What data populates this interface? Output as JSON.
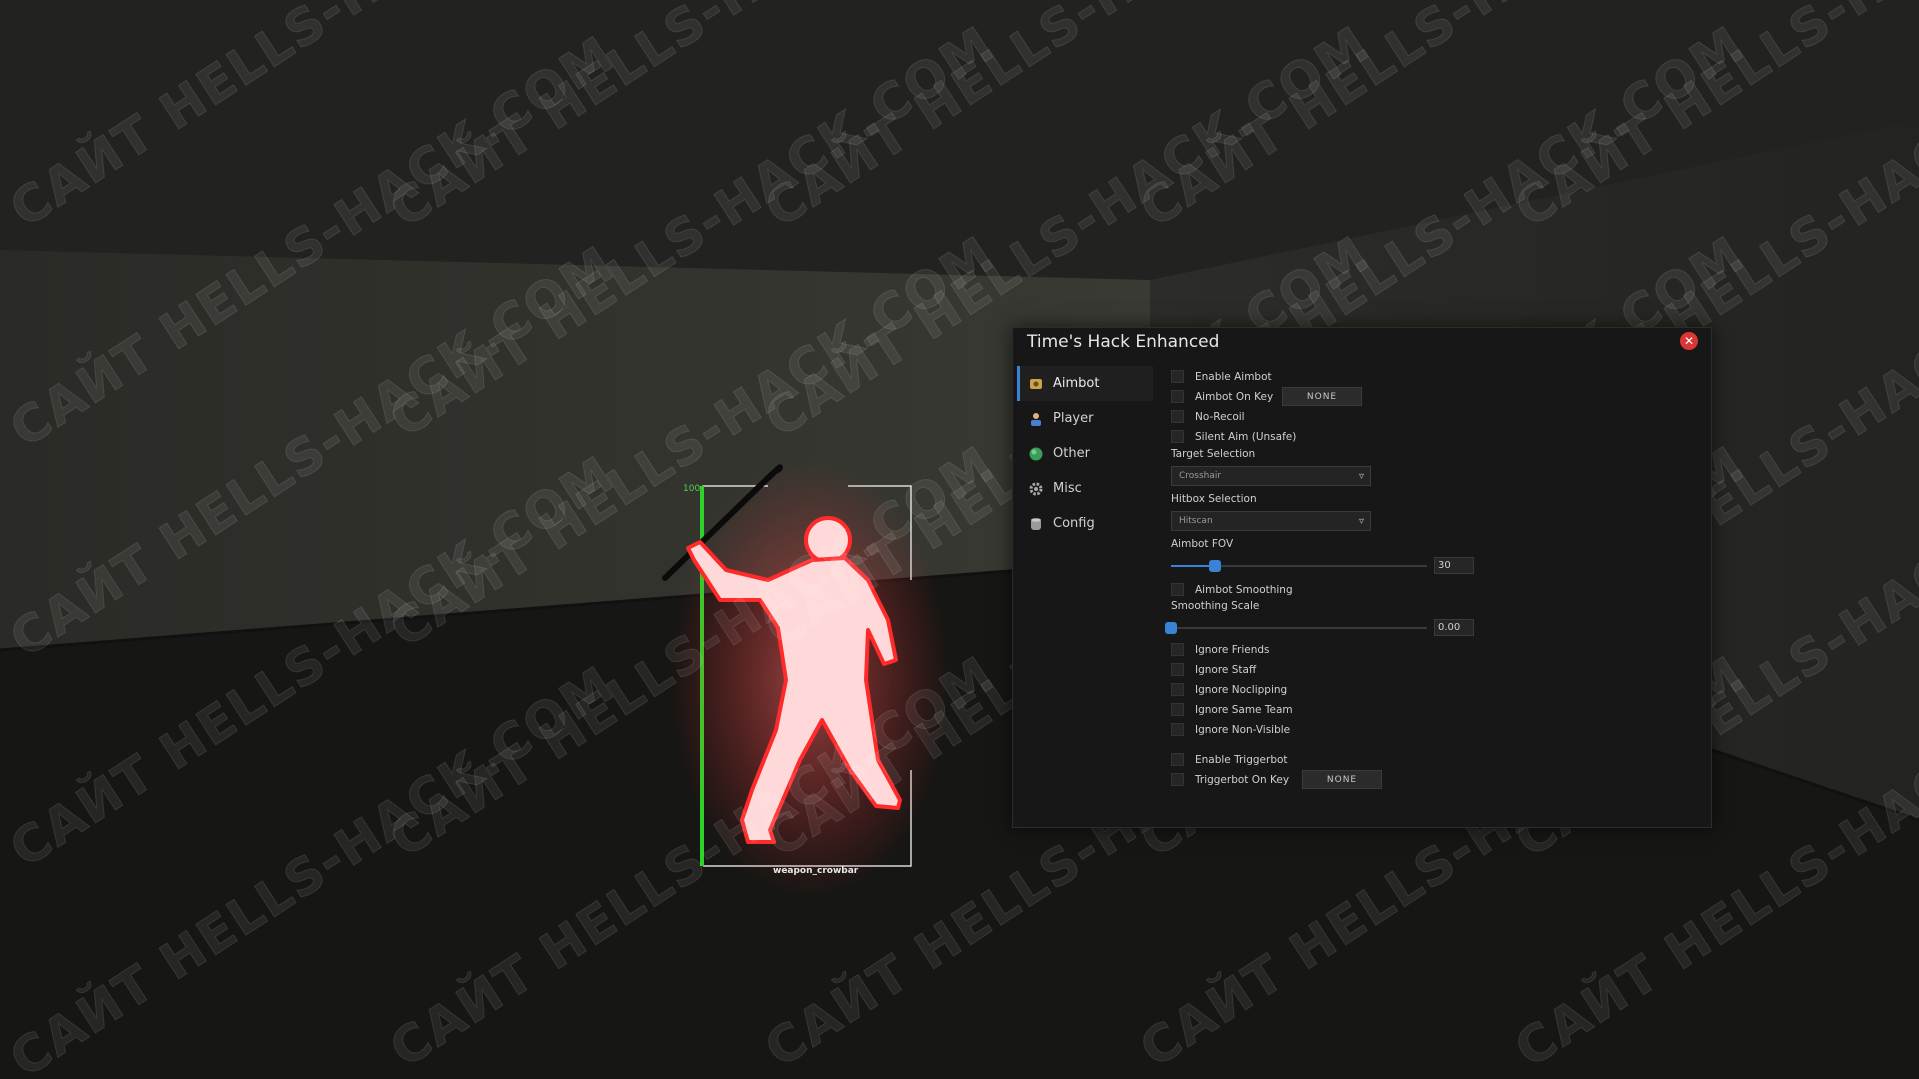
{
  "window": {
    "title": "Time's Hack Enhanced",
    "close_icon": "close-icon"
  },
  "sidebar": {
    "items": [
      {
        "label": "Aimbot",
        "icon": "crosshair-icon",
        "active": true
      },
      {
        "label": "Player",
        "icon": "person-icon",
        "active": false
      },
      {
        "label": "Other",
        "icon": "globe-icon",
        "active": false
      },
      {
        "label": "Misc",
        "icon": "gear-icon",
        "active": false
      },
      {
        "label": "Config",
        "icon": "database-icon",
        "active": false
      }
    ]
  },
  "aimbot": {
    "enable_aimbot": {
      "label": "Enable Aimbot",
      "checked": false
    },
    "aimbot_on_key": {
      "label": "Aimbot On Key",
      "checked": false,
      "key": "NONE"
    },
    "no_recoil": {
      "label": "No-Recoil",
      "checked": false
    },
    "silent_aim": {
      "label": "Silent Aim (Unsafe)",
      "checked": false
    },
    "target_selection": {
      "label": "Target Selection",
      "value": "Crosshair"
    },
    "hitbox_selection": {
      "label": "Hitbox Selection",
      "value": "Hitscan"
    },
    "aimbot_fov": {
      "label": "Aimbot FOV",
      "value": "30",
      "fraction": 0.17
    },
    "aimbot_smoothing": {
      "label": "Aimbot Smoothing",
      "checked": false
    },
    "smoothing_scale": {
      "label": "Smoothing Scale",
      "value": "0.00",
      "fraction": 0.0
    },
    "ignore_friends": {
      "label": "Ignore Friends",
      "checked": false
    },
    "ignore_staff": {
      "label": "Ignore Staff",
      "checked": false
    },
    "ignore_noclipping": {
      "label": "Ignore Noclipping",
      "checked": false
    },
    "ignore_same_team": {
      "label": "Ignore Same Team",
      "checked": false
    },
    "ignore_non_visible": {
      "label": "Ignore Non-Visible",
      "checked": false
    },
    "enable_triggerbot": {
      "label": "Enable Triggerbot",
      "checked": false
    },
    "triggerbot_on_key": {
      "label": "Triggerbot On Key",
      "checked": false,
      "key": "NONE"
    }
  },
  "esp": {
    "health": "100",
    "health_fraction": 1.0,
    "weapon": "weapon_crowbar"
  },
  "watermark": {
    "text": "САЙТ HELLS-HACK.COM"
  },
  "colors": {
    "accent": "#3a82d6",
    "health_bar": "#2fd12a",
    "chams": "#ff2a2a",
    "close": "#d93636"
  }
}
